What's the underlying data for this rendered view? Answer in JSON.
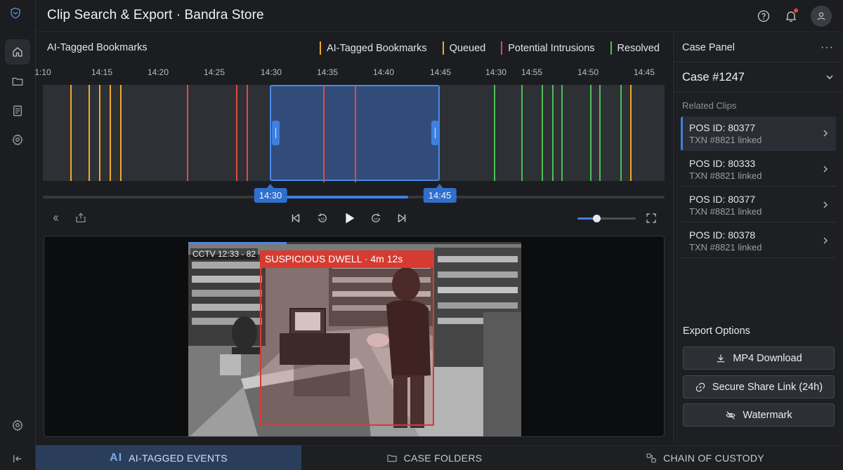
{
  "app": {
    "title": "Clip Search & Export · Bandra Store"
  },
  "rail": {
    "items": [
      "shield-logo",
      "home-icon",
      "folder-icon",
      "document-icon",
      "settings-icon"
    ],
    "bottom": [
      "settings-icon",
      "collapse-icon"
    ]
  },
  "bookmarks": {
    "title": "AI-Tagged Bookmarks",
    "legend": [
      {
        "label": "AI-Tagged Bookmarks",
        "color": "#f0a92c"
      },
      {
        "label": "Queued",
        "color": "#f0a92c"
      },
      {
        "label": "Potential Intrusions",
        "color": "#e5483d"
      },
      {
        "label": "Resolved",
        "color": "#4fbf55"
      }
    ]
  },
  "timeline": {
    "ticks": [
      "1:10",
      "14:15",
      "14:20",
      "14:25",
      "14:30",
      "14:35",
      "14:40",
      "14:45",
      "14:30",
      "14:55",
      "14:50",
      "14:45"
    ],
    "selection_start": "14:30",
    "selection_end": "14:45"
  },
  "video": {
    "overlay_text": "CCTV  12:33 - 82",
    "alert": "SUSPICIOUS DWELL · 4m 12s",
    "progress": 0.29,
    "volume": 0.31
  },
  "panel": {
    "title": "Case Panel",
    "case": "Case #1247",
    "related_label": "Related Clips",
    "clips": [
      {
        "id": "POS ID: 80377",
        "txn": "TXN #8821 linked"
      },
      {
        "id": "POS ID: 80333",
        "txn": "TXN #8821 linked"
      },
      {
        "id": "POS ID: 80377",
        "txn": "TXN #8821 linked"
      },
      {
        "id": "POS ID: 80378",
        "txn": "TXN #8821 linked"
      }
    ],
    "export_label": "Export Options",
    "export": {
      "mp4": "MP4 Download",
      "share": "Secure Share Link (24h)",
      "watermark": "Watermark"
    }
  },
  "tabs": {
    "ai_badge": "AI",
    "events": "AI-TAGGED EVENTS",
    "folders": "CASE FOLDERS",
    "custody": "CHAIN OF CUSTODY"
  },
  "colors": {
    "accent": "#3f7fe0",
    "alert": "#d63b31",
    "amber": "#f0a92c",
    "red": "#e5483d",
    "green": "#4fbf55"
  }
}
